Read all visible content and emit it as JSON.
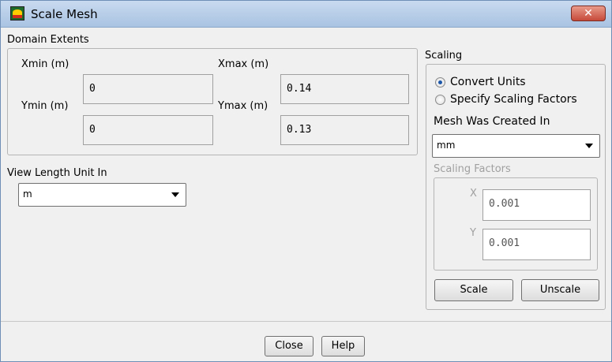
{
  "window": {
    "title": "Scale Mesh",
    "close_glyph": "✕"
  },
  "domain_extents": {
    "title": "Domain Extents",
    "xmin_label": "Xmin (m)",
    "xmin_value": "0",
    "xmax_label": "Xmax (m)",
    "xmax_value": "0.14",
    "ymin_label": "Ymin (m)",
    "ymin_value": "0",
    "ymax_label": "Ymax (m)",
    "ymax_value": "0.13"
  },
  "view_length": {
    "label": "View Length Unit In",
    "selected": "m"
  },
  "scaling": {
    "title": "Scaling",
    "options": [
      "Convert Units",
      "Specify Scaling Factors"
    ],
    "selected_option": "Convert Units",
    "mesh_created_label": "Mesh Was Created In",
    "mesh_created_selected": "mm",
    "factors_label": "Scaling Factors",
    "x_label": "X",
    "x_value": "0.001",
    "y_label": "Y",
    "y_value": "0.001",
    "scale_button": "Scale",
    "unscale_button": "Unscale"
  },
  "footer": {
    "close_button": "Close",
    "help_button": "Help"
  }
}
